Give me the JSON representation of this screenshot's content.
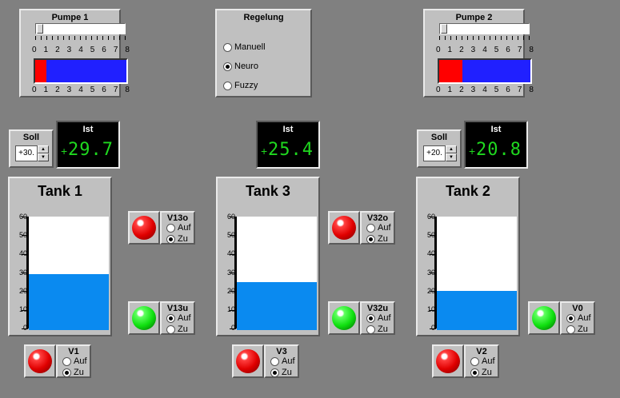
{
  "pumps": [
    {
      "id": "pumpe1",
      "title": "Pumpe 1",
      "slider_position": 0,
      "flow": 1,
      "scale": [
        "0",
        "1",
        "2",
        "3",
        "4",
        "5",
        "6",
        "7",
        "8"
      ]
    },
    {
      "id": "pumpe2",
      "title": "Pumpe 2",
      "slider_position": 0,
      "flow": 2,
      "scale": [
        "0",
        "1",
        "2",
        "3",
        "4",
        "5",
        "6",
        "7",
        "8"
      ]
    }
  ],
  "regelung": {
    "title": "Regelung",
    "options": [
      "Manuell",
      "Neuro",
      "Fuzzy"
    ],
    "selected": "Neuro"
  },
  "setpoints": [
    {
      "id": "tank1",
      "label": "Soll",
      "value": "+30."
    },
    {
      "id": "tank2",
      "label": "Soll",
      "value": "+20."
    }
  ],
  "ist": [
    {
      "id": "tank1",
      "label": "Ist",
      "sign": "+",
      "value": "29.7"
    },
    {
      "id": "tank3",
      "label": "Ist",
      "sign": "+",
      "value": "25.4"
    },
    {
      "id": "tank2",
      "label": "Ist",
      "sign": "+",
      "value": "20.8"
    }
  ],
  "tanks": [
    {
      "id": "tank1",
      "name": "Tank 1",
      "level": 29.7,
      "max": 60,
      "scale": [
        "60",
        "50",
        "40",
        "30",
        "20",
        "10",
        "0"
      ]
    },
    {
      "id": "tank3",
      "name": "Tank 3",
      "level": 25.4,
      "max": 60,
      "scale": [
        "60",
        "50",
        "40",
        "30",
        "20",
        "10",
        "0"
      ]
    },
    {
      "id": "tank2",
      "name": "Tank 2",
      "level": 20.8,
      "max": 60,
      "scale": [
        "60",
        "50",
        "40",
        "30",
        "20",
        "10",
        "0"
      ]
    }
  ],
  "valves": [
    {
      "id": "V1",
      "name": "V1",
      "state": "Zu",
      "lamp": "red",
      "opt_open": "Auf",
      "opt_close": "Zu"
    },
    {
      "id": "V13o",
      "name": "V13o",
      "state": "Zu",
      "lamp": "red",
      "opt_open": "Auf",
      "opt_close": "Zu"
    },
    {
      "id": "V13u",
      "name": "V13u",
      "state": "Auf",
      "lamp": "green",
      "opt_open": "Auf",
      "opt_close": "Zu"
    },
    {
      "id": "V3",
      "name": "V3",
      "state": "Zu",
      "lamp": "red",
      "opt_open": "Auf",
      "opt_close": "Zu"
    },
    {
      "id": "V32o",
      "name": "V32o",
      "state": "Zu",
      "lamp": "red",
      "opt_open": "Auf",
      "opt_close": "Zu"
    },
    {
      "id": "V32u",
      "name": "V32u",
      "state": "Auf",
      "lamp": "green",
      "opt_open": "Auf",
      "opt_close": "Zu"
    },
    {
      "id": "V2",
      "name": "V2",
      "state": "Zu",
      "lamp": "red",
      "opt_open": "Auf",
      "opt_close": "Zu"
    },
    {
      "id": "V0",
      "name": "V0",
      "state": "Auf",
      "lamp": "green",
      "opt_open": "Auf",
      "opt_close": "Zu"
    }
  ],
  "colors": {
    "background": "#808080",
    "panel": "#c0c0c0",
    "water": "#0a8af0",
    "digits": "#1fd81f",
    "bar": "#2020ff",
    "bar_fill": "#ff0000"
  }
}
